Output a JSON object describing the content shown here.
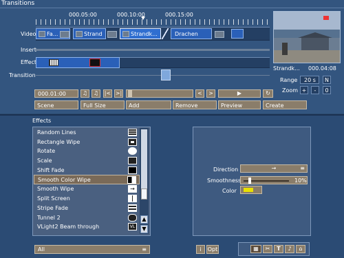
{
  "window": {
    "title": "Transitions"
  },
  "ruler": {
    "ticks": [
      "000.05:00",
      "000.10:00",
      "000.15:00"
    ]
  },
  "tracks": {
    "video_label": "Video",
    "insert_label": "Insert",
    "effect_label": "Effect",
    "transition_label": "Transition",
    "clips": [
      {
        "label": "Fa..."
      },
      {
        "label": "Strand"
      },
      {
        "label": "Strandk..."
      },
      {
        "label": "Drachen"
      }
    ]
  },
  "preview": {
    "clip_name": "Strandk...",
    "timecode": "000.04:08",
    "range_label": "Range",
    "range_value": "20 s",
    "range_n": "N",
    "zoom_label": "Zoom",
    "zoom_in": "+",
    "zoom_out": "-",
    "zoom_reset": "0"
  },
  "transport": {
    "timecode": "000.01:00",
    "buttons": [
      "Scene",
      "Full Size",
      "Add",
      "Remove",
      "Preview",
      "Create"
    ]
  },
  "effects": {
    "title": "Effects",
    "items": [
      {
        "label": "Random Lines"
      },
      {
        "label": "Rectangle Wipe"
      },
      {
        "label": "Rotate"
      },
      {
        "label": "Scale"
      },
      {
        "label": "Shift Fade"
      },
      {
        "label": "Smooth Color Wipe"
      },
      {
        "label": "Smooth Wipe"
      },
      {
        "label": "Split Screen"
      },
      {
        "label": "Stripe Fade"
      },
      {
        "label": "Tunnel 2"
      },
      {
        "label": "VLight2 Beam through"
      }
    ],
    "selected_index": 5,
    "filter_value": "All"
  },
  "properties": {
    "direction_label": "Direction",
    "direction_value": "→",
    "smoothness_label": "Smoothness",
    "smoothness_value": "10%",
    "smoothness_fraction": 0.1,
    "color_label": "Color",
    "color_value": "#e8e000"
  },
  "footer": {
    "info": "i",
    "opt": "Opt"
  }
}
